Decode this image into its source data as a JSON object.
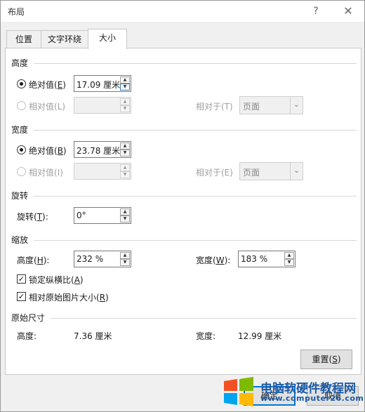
{
  "window": {
    "title": "布局",
    "help_glyph": "?",
    "close_glyph": "✕"
  },
  "tabs": [
    {
      "label": "位置",
      "active": false
    },
    {
      "label": "文字环绕",
      "active": false
    },
    {
      "label": "大小",
      "active": true
    }
  ],
  "height_section": {
    "title": "高度",
    "absolute": {
      "label": "绝对值(",
      "key": "E",
      "close": ")",
      "value": "17.09 厘米",
      "checked": true
    },
    "relative": {
      "label": "相对值(",
      "key": "L",
      "close": ")",
      "value": ""
    },
    "relative_to": {
      "label": "相对于(T)",
      "value": "页面"
    }
  },
  "width_section": {
    "title": "宽度",
    "absolute": {
      "label": "绝对值(",
      "key": "B",
      "close": ")",
      "value": "23.78 厘米",
      "checked": true
    },
    "relative": {
      "label": "相对值(",
      "key": "I",
      "close": ")",
      "value": ""
    },
    "relative_to": {
      "label": "相对于(E)",
      "value": "页面"
    }
  },
  "rotate_section": {
    "title": "旋转",
    "rotation": {
      "label": "旋转(",
      "key": "T",
      "close": "):",
      "value": "0°"
    }
  },
  "scale_section": {
    "title": "缩放",
    "height": {
      "label": "高度(",
      "key": "H",
      "close": "):",
      "value": "232 %"
    },
    "width": {
      "label": "宽度(",
      "key": "W",
      "close": "):",
      "value": "183 %"
    },
    "lock_aspect": {
      "label": "锁定纵横比(",
      "key": "A",
      "close": ")",
      "checked": true
    },
    "relative_original": {
      "label": "相对原始图片大小(",
      "key": "R",
      "close": ")",
      "checked": true
    }
  },
  "original_section": {
    "title": "原始尺寸",
    "height_label": "高度:",
    "height_value": "7.36 厘米",
    "width_label": "宽度:",
    "width_value": "12.99 厘米"
  },
  "buttons": {
    "reset": {
      "label": "重置(",
      "key": "S",
      "close": ")"
    },
    "ok": "确定",
    "cancel": "取消"
  },
  "watermark": {
    "text": "电脑软硬件教程网",
    "url": "www.computer26.com"
  },
  "check_glyph": "✓",
  "arrow_up": "▲",
  "arrow_down": "▼",
  "combo_arrow": "⌄"
}
